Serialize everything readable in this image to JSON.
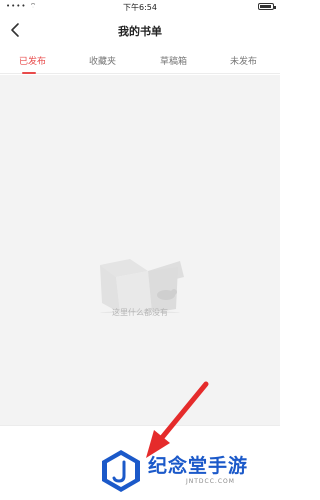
{
  "status_bar": {
    "signal": "•••• ⌔",
    "time": "下午6:54"
  },
  "header": {
    "title": "我的书单"
  },
  "tabs": [
    {
      "label": "已发布",
      "active": true
    },
    {
      "label": "收藏夹",
      "active": false
    },
    {
      "label": "草稿箱",
      "active": false
    },
    {
      "label": "未发布",
      "active": false
    }
  ],
  "empty_state": {
    "message": "这里什么都没有"
  },
  "colors": {
    "accent": "#e84b4b",
    "background": "#f3f3f3",
    "arrow": "#e52b2b",
    "watermark": "#1b59c9"
  },
  "watermark": {
    "brand": "纪念堂手游",
    "domain": "JNTDCC.COM"
  }
}
